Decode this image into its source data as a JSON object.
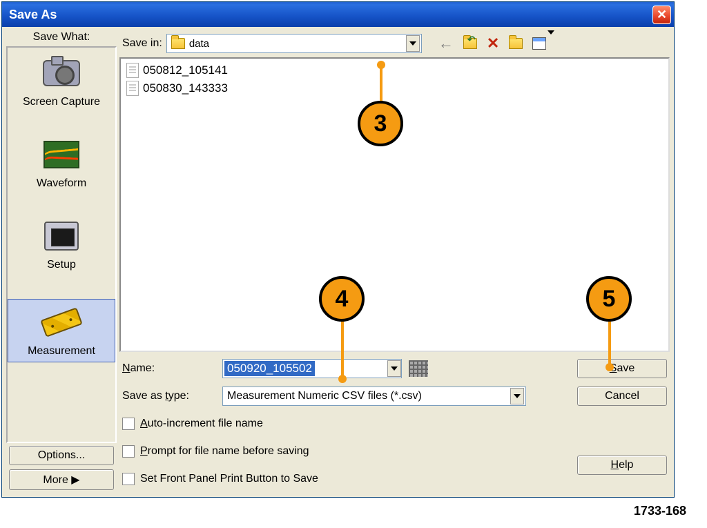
{
  "window": {
    "title": "Save As"
  },
  "sidebar": {
    "title": "Save What:",
    "items": [
      {
        "label": "Screen Capture"
      },
      {
        "label": "Waveform"
      },
      {
        "label": "Setup"
      },
      {
        "label": "Measurement"
      }
    ],
    "options_btn": "Options...",
    "more_btn": "More  ▶"
  },
  "topbar": {
    "save_in_label": "Save in:",
    "save_in_value": "data"
  },
  "files": [
    "050812_105141",
    "050830_143333"
  ],
  "bottom": {
    "name_label": "Name:",
    "name_value": "050920_105502",
    "type_label": "Save as type:",
    "type_value": "Measurement Numeric CSV files (*.csv)",
    "auto_increment": "Auto-increment file name",
    "prompt": "Prompt for file name before saving",
    "front_panel": "Set Front Panel Print Button to Save"
  },
  "buttons": {
    "save": "Save",
    "cancel": "Cancel",
    "help": "Help"
  },
  "annotations": {
    "a3": "3",
    "a4": "4",
    "a5": "5"
  },
  "figure_ref": "1733-168"
}
